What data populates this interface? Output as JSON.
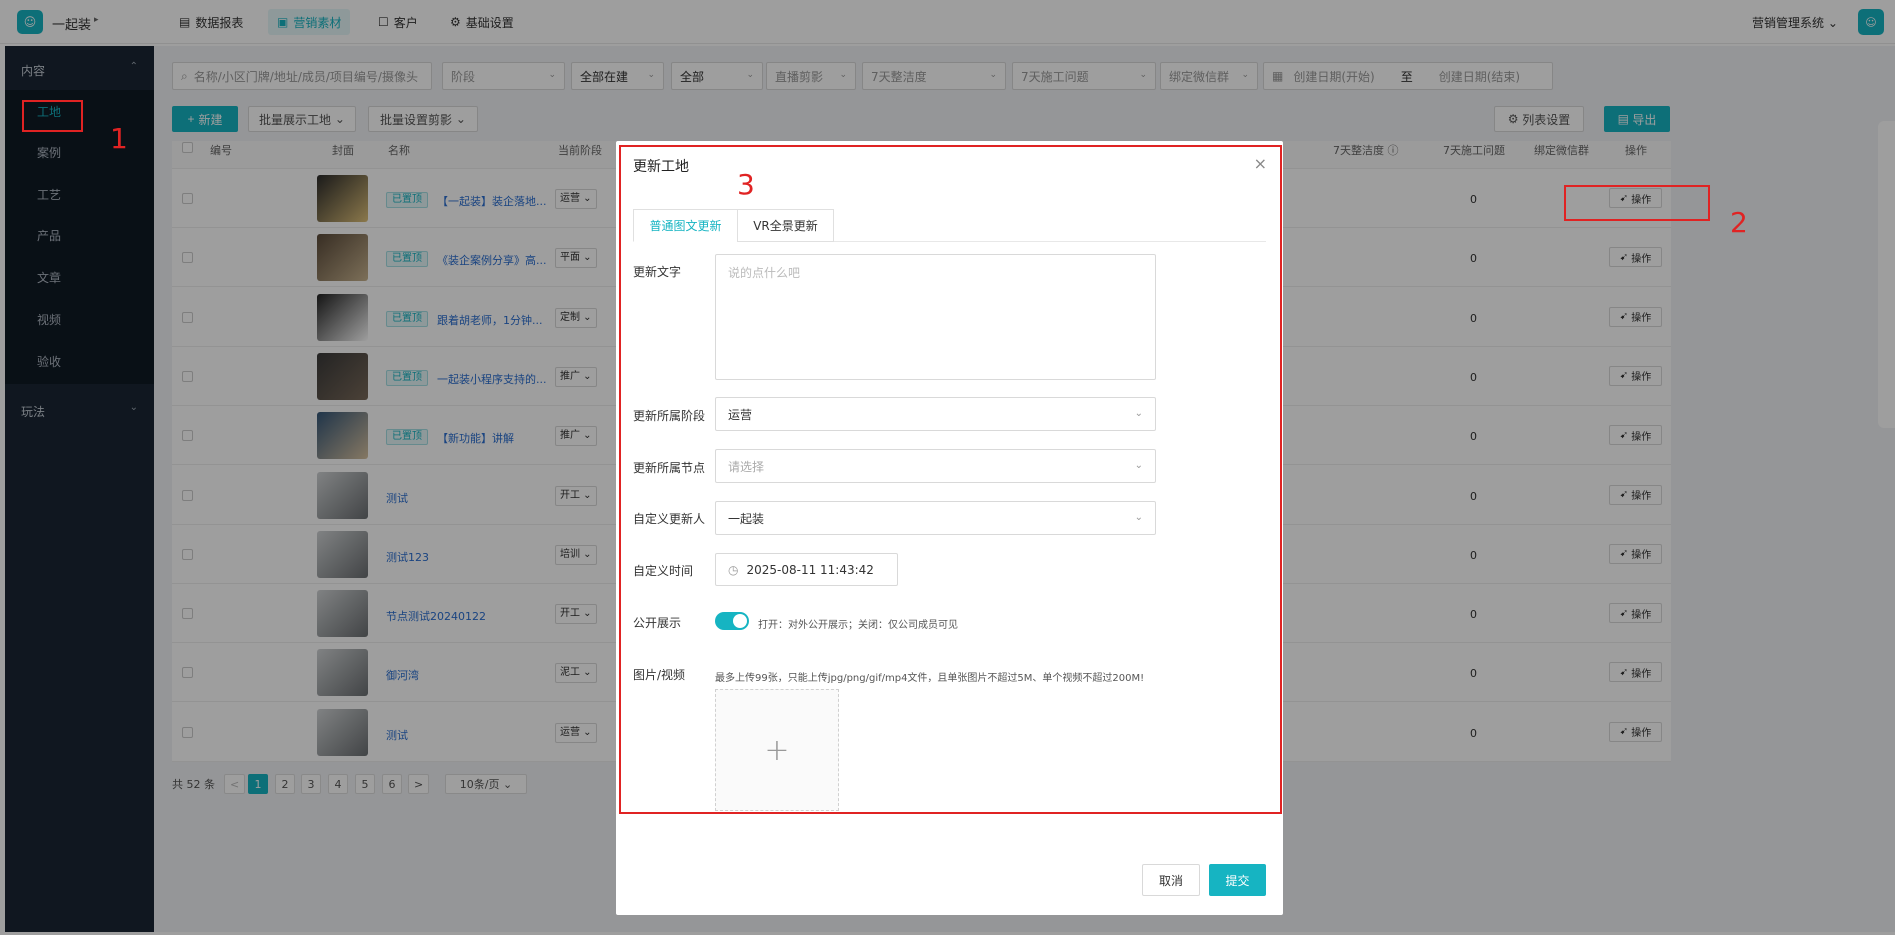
{
  "header": {
    "brand": "一起装",
    "nav": [
      {
        "label": "数据报表",
        "icon": "report-icon"
      },
      {
        "label": "营销素材",
        "icon": "material-icon",
        "active": true
      },
      {
        "label": "客户",
        "icon": "customer-icon"
      },
      {
        "label": "基础设置",
        "icon": "settings-icon"
      }
    ],
    "system": "营销管理系统"
  },
  "sidebar": {
    "group1": "内容",
    "items": [
      "工地",
      "案例",
      "工艺",
      "产品",
      "文章",
      "视频",
      "验收"
    ],
    "group2": "玩法"
  },
  "filters": {
    "search_placeholder": "名称/小区门牌/地址/成员/项目编号/摄像头",
    "stage": "阶段",
    "build_status": "全部在建",
    "all": "全部",
    "camera": "直播剪影",
    "clean": "7天整洁度",
    "issues": "7天施工问题",
    "wechat": "绑定微信群",
    "date_start": "创建日期(开始)",
    "date_sep": "至",
    "date_end": "创建日期(结束)"
  },
  "toolbar": {
    "new": "新建",
    "batch_show": "批量展示工地",
    "batch_camera": "批量设置剪影",
    "list_settings": "列表设置",
    "export": "导出"
  },
  "table": {
    "headers": {
      "id": "编号",
      "cover": "封面",
      "name": "名称",
      "stage": "当前阶段",
      "clean": "7天整洁度",
      "issues": "7天施工问题",
      "wechat": "绑定微信群",
      "op": "操作"
    },
    "op_label": "操作",
    "pinned_tag": "已置顶",
    "rows": [
      {
        "pinned": true,
        "name": "【一起装】装企落地...",
        "stage": "运营",
        "issues": "0"
      },
      {
        "pinned": true,
        "name": "《装企案例分享》高...",
        "stage": "平面",
        "issues": "0"
      },
      {
        "pinned": true,
        "name": "跟着胡老师，1分钟...",
        "stage": "定制",
        "issues": "0"
      },
      {
        "pinned": true,
        "name": "一起装小程序支持的...",
        "stage": "推广",
        "issues": "0"
      },
      {
        "pinned": true,
        "name": "【新功能】讲解",
        "stage": "推广",
        "issues": "0"
      },
      {
        "pinned": false,
        "name": "测试",
        "stage": "开工",
        "issues": "0"
      },
      {
        "pinned": false,
        "name": "测试123",
        "stage": "培训",
        "issues": "0"
      },
      {
        "pinned": false,
        "name": "节点测试20240122",
        "stage": "开工",
        "issues": "0"
      },
      {
        "pinned": false,
        "name": "御河湾",
        "stage": "泥工",
        "issues": "0"
      },
      {
        "pinned": false,
        "name": "测试",
        "stage": "运营",
        "issues": "0"
      }
    ]
  },
  "pagination": {
    "total": "共 52 条",
    "prev": "<",
    "pages": [
      "1",
      "2",
      "3",
      "4",
      "5",
      "6"
    ],
    "next": ">",
    "page_size": "10条/页"
  },
  "modal": {
    "title": "更新工地",
    "close": "×",
    "tabs": [
      "普通图文更新",
      "VR全景更新"
    ],
    "text_label": "更新文字",
    "text_placeholder": "说的点什么吧",
    "stage_label": "更新所属阶段",
    "stage_value": "运营",
    "node_label": "更新所属节点",
    "node_placeholder": "请选择",
    "updater_label": "自定义更新人",
    "updater_value": "一起装",
    "time_label": "自定义时间",
    "time_value": "2025-08-11 11:43:42",
    "public_label": "公开展示",
    "public_hint": "打开：对外公开展示；关闭：仅公司成员可见",
    "media_label": "图片/视频",
    "media_hint": "最多上传99张，只能上传jpg/png/gif/mp4文件，且单张图片不超过5M、单个视频不超过200M!",
    "upload_plus": "+",
    "cancel": "取消",
    "submit": "提交"
  },
  "annotations": [
    "1",
    "2",
    "3"
  ],
  "colors": {
    "accent": "#16b4c2",
    "sidebar": "#1a2634",
    "annotation": "#e02323"
  }
}
